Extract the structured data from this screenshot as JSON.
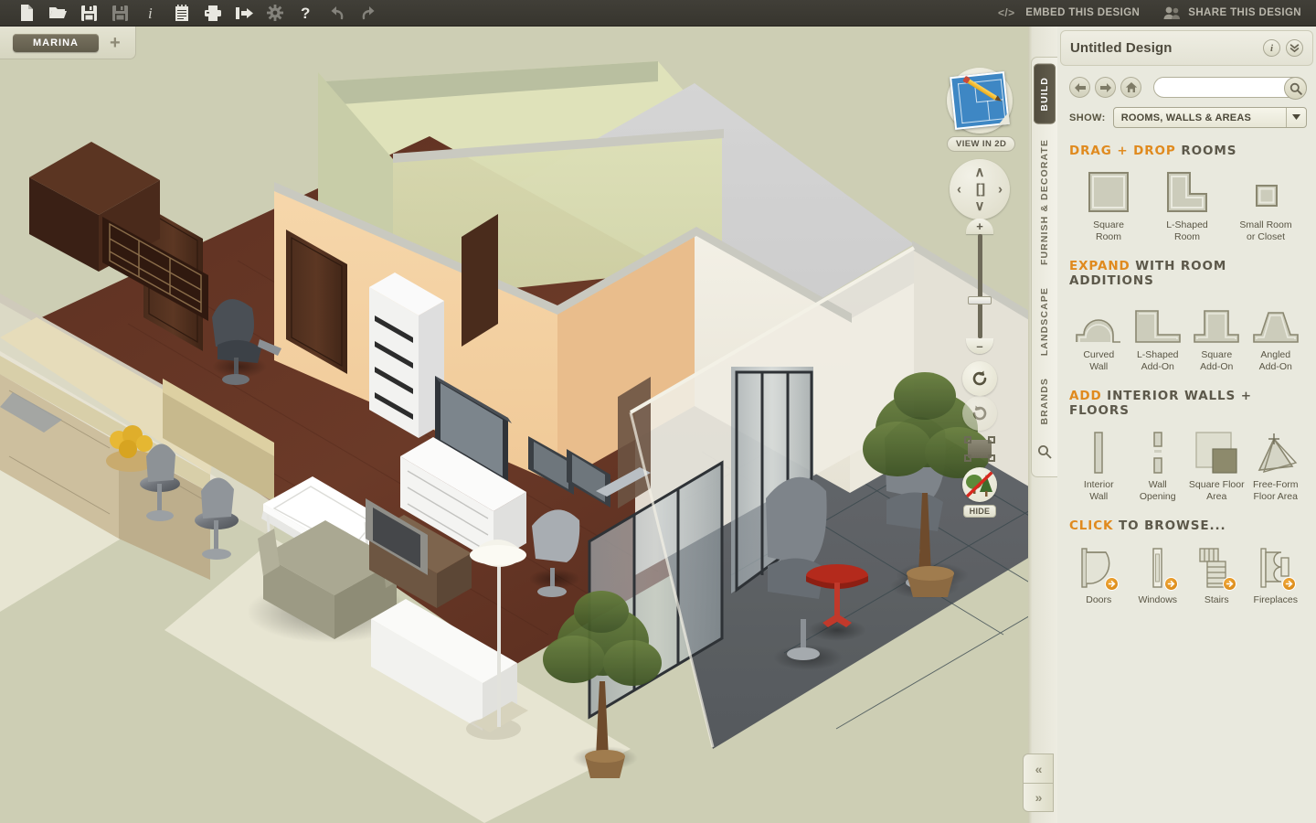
{
  "toolbar": {
    "icons": [
      {
        "name": "new-document-icon",
        "label": "New",
        "disabled": false
      },
      {
        "name": "open-folder-icon",
        "label": "Open",
        "disabled": false
      },
      {
        "name": "save-icon",
        "label": "Save",
        "disabled": false
      },
      {
        "name": "save-as-icon",
        "label": "Save As",
        "disabled": true
      },
      {
        "name": "info-icon",
        "label": "Info",
        "disabled": false
      },
      {
        "name": "notes-icon",
        "label": "Notes",
        "disabled": false
      },
      {
        "name": "print-icon",
        "label": "Print",
        "disabled": false
      },
      {
        "name": "export-icon",
        "label": "Export",
        "disabled": false
      },
      {
        "name": "settings-gear-icon",
        "label": "Settings",
        "disabled": true
      },
      {
        "name": "help-icon",
        "label": "Help",
        "disabled": false
      },
      {
        "name": "undo-icon",
        "label": "Undo",
        "disabled": true
      },
      {
        "name": "redo-icon",
        "label": "Redo",
        "disabled": true
      }
    ],
    "embed_label": "EMBED THIS DESIGN",
    "share_label": "SHARE THIS DESIGN"
  },
  "project_tabs": {
    "active": "MARINA",
    "add_label": "+"
  },
  "viewport": {
    "view_2d_label": "VIEW IN 2D",
    "hide_label": "HIDE",
    "nav": {
      "up": "∧",
      "down": "∨",
      "left": "‹",
      "right": "›",
      "center": "[ ]"
    },
    "zoom": {
      "in": "+",
      "out": "–"
    },
    "collapse_left": "«",
    "collapse_right": "»"
  },
  "rail": {
    "tabs": [
      {
        "label": "BUILD",
        "active": true
      },
      {
        "label": "FURNISH & DECORATE",
        "active": false
      },
      {
        "label": "LANDSCAPE",
        "active": false
      },
      {
        "label": "BRANDS",
        "active": false
      }
    ]
  },
  "panel": {
    "title": "Untitled Design",
    "info_label": "i",
    "collapse_label": "»",
    "search": {
      "value": "",
      "placeholder": ""
    },
    "show_label": "SHOW:",
    "show_value": "ROOMS, WALLS & AREAS",
    "sections": [
      {
        "name": "drag-drop-rooms",
        "head_accent": "DRAG + DROP",
        "head_rest": "ROOMS",
        "items": [
          {
            "label": "Square\nRoom",
            "icon": "square-room-icon",
            "badge": false
          },
          {
            "label": "L-Shaped\nRoom",
            "icon": "l-shaped-room-icon",
            "badge": false
          },
          {
            "label": "Small Room\nor Closet",
            "icon": "small-room-icon",
            "badge": false
          }
        ]
      },
      {
        "name": "room-additions",
        "head_accent": "EXPAND",
        "head_rest": "WITH ROOM ADDITIONS",
        "items": [
          {
            "label": "Curved\nWall",
            "icon": "curved-wall-icon",
            "badge": false
          },
          {
            "label": "L-Shaped\nAdd-On",
            "icon": "l-shaped-addon-icon",
            "badge": false
          },
          {
            "label": "Square\nAdd-On",
            "icon": "square-addon-icon",
            "badge": false
          },
          {
            "label": "Angled\nAdd-On",
            "icon": "angled-addon-icon",
            "badge": false
          }
        ]
      },
      {
        "name": "interior-walls-floors",
        "head_accent": "ADD",
        "head_rest": "INTERIOR WALLS + FLOORS",
        "items": [
          {
            "label": "Interior\nWall",
            "icon": "interior-wall-icon",
            "badge": false
          },
          {
            "label": "Wall\nOpening",
            "icon": "wall-opening-icon",
            "badge": false
          },
          {
            "label": "Square Floor\nArea",
            "icon": "square-floor-area-icon",
            "badge": false
          },
          {
            "label": "Free-Form\nFloor Area",
            "icon": "free-form-floor-area-icon",
            "badge": false
          }
        ]
      },
      {
        "name": "click-to-browse",
        "head_accent": "CLICK",
        "head_rest": "TO BROWSE...",
        "items": [
          {
            "label": "Doors",
            "icon": "doors-icon",
            "badge": true
          },
          {
            "label": "Windows",
            "icon": "windows-icon",
            "badge": true
          },
          {
            "label": "Stairs",
            "icon": "stairs-icon",
            "badge": true
          },
          {
            "label": "Fireplaces",
            "icon": "fireplaces-icon",
            "badge": true
          }
        ]
      }
    ]
  },
  "colors": {
    "toolbar_bg": "#3b3932",
    "canvas_bg": "#cdceb4",
    "panel_bg": "#e9e9de",
    "accent_orange": "#e08a1e",
    "active_tab": "#5a5546"
  }
}
